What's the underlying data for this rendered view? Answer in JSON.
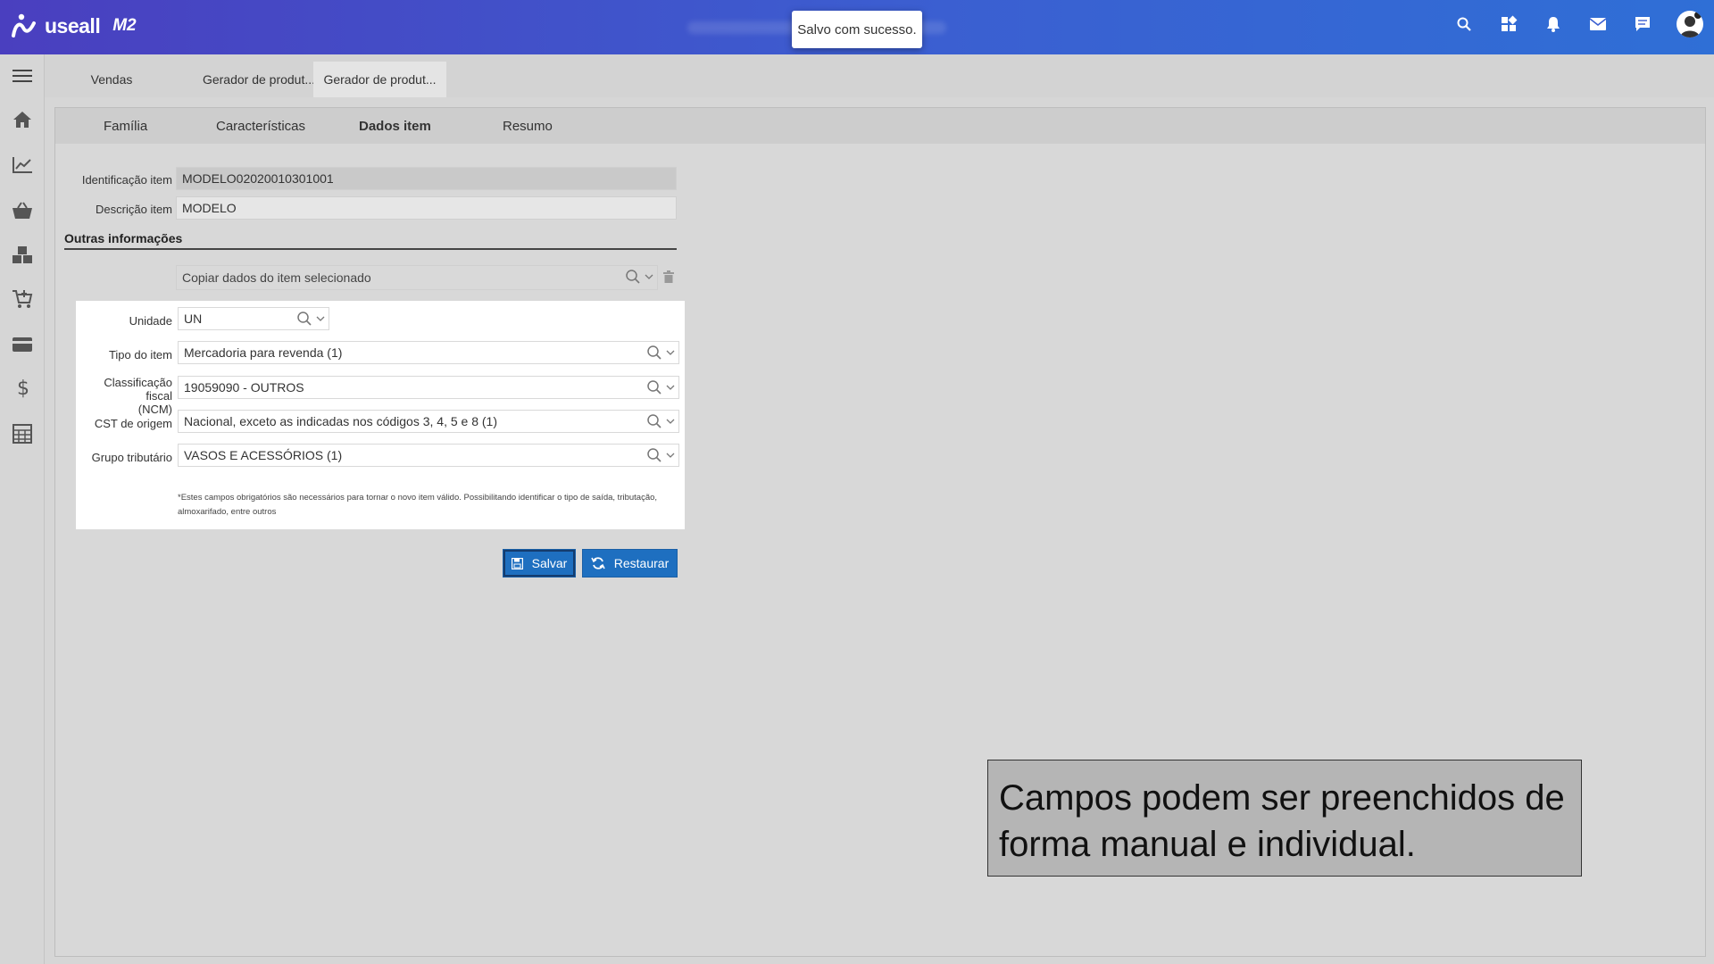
{
  "header": {
    "brand": "useall",
    "brand_sub": "M2",
    "toast": "Salvo com sucesso.",
    "icons": [
      "search-icon",
      "apps-icon",
      "bell-icon",
      "mail-icon",
      "chat-icon",
      "user-avatar"
    ]
  },
  "sidebar": {
    "items": [
      "menu-icon",
      "home-icon",
      "chart-line-icon",
      "basket-icon",
      "boxes-icon",
      "cart-icon",
      "card-icon",
      "dollar-icon",
      "calculator-icon"
    ]
  },
  "tabs": [
    {
      "label": "Vendas"
    },
    {
      "label": "Gerador de produt..."
    },
    {
      "label": "Gerador de produt..."
    }
  ],
  "steps": [
    {
      "label": "Família"
    },
    {
      "label": "Características"
    },
    {
      "label": "Dados item"
    },
    {
      "label": "Resumo"
    }
  ],
  "form": {
    "identificacao_label": "Identificação item",
    "identificacao_value": "MODELO02020010301001",
    "descricao_label": "Descrição item",
    "descricao_value": "MODELO",
    "section_title": "Outras informações",
    "copy_placeholder": "Copiar dados do item selecionado",
    "unidade_label": "Unidade",
    "unidade_value": "UN",
    "tipo_label": "Tipo do item",
    "tipo_value": "Mercadoria para revenda (1)",
    "ncm_label_1": "Classificação fiscal",
    "ncm_label_2": "(NCM)",
    "ncm_value": "19059090 - OUTROS",
    "cst_label": "CST de origem",
    "cst_value": "Nacional, exceto as indicadas nos códigos 3, 4, 5 e 8 (1)",
    "grupo_label": "Grupo tributário",
    "grupo_value": "VASOS E ACESSÓRIOS (1)",
    "note": "*Estes campos obrigatórios são necessários para tornar o novo item válido. Possibilitando identificar o tipo de saída, tributação, almoxarifado, entre outros"
  },
  "buttons": {
    "save": "Salvar",
    "restore": "Restaurar"
  },
  "caption": "Campos podem ser preenchidos de forma manual e individual.",
  "colors": {
    "header_start": "#4a3fbf",
    "header_end": "#2f6fd6",
    "button": "#1e6fc0"
  }
}
